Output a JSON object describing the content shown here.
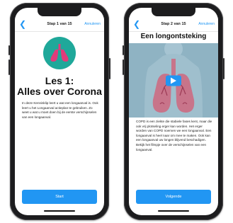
{
  "left": {
    "nav": {
      "step": "Stap 1 van 15",
      "cancel": "Annuleren"
    },
    "lesson_title_line1": "Les 1:",
    "lesson_title_line2": "Alles over Corona",
    "body": "In deze Kennisklip leert u wat een longaanval is. Ook leert u het Longaanval actieplan te gebruiken. Zo weet u wat u moet doen bij de eerste verschijnselen van een longaanval.",
    "button": "Start"
  },
  "right": {
    "nav": {
      "step": "Stap 2 van 15",
      "cancel": "Annuleren"
    },
    "title": "Een longontsteking",
    "body": "COPD is een ziekte die stabiele fases kent, maar die ook vrij plotseling erger kan worden. Het erger worden van COPD noemen we een longaanval. Een longaanval is heel naar om mee te maken. Ook kan een longaanval uw longen blijvend beschadigen. Bekijk het filmpje over de verschijnselen van een longaanval.",
    "button": "Volgende"
  },
  "colors": {
    "accent": "#2196f3",
    "lung_circle": "#1fa89a",
    "lung": "#e23b7a"
  },
  "icons": {
    "back": "chevron-left-icon",
    "lungs": "lungs-icon",
    "play": "play-icon"
  }
}
